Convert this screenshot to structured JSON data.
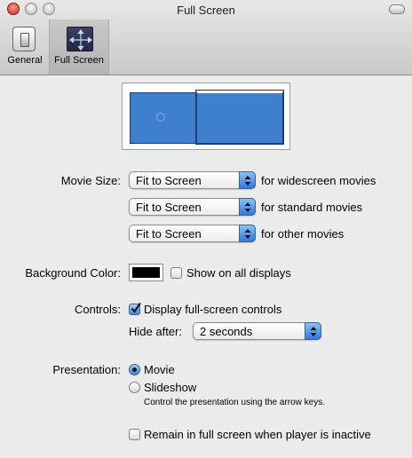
{
  "window": {
    "title": "Full Screen"
  },
  "toolbar": {
    "items": [
      {
        "label": "General",
        "icon": "switch-icon",
        "selected": false
      },
      {
        "label": "Full Screen",
        "icon": "fullscreen-arrows-icon",
        "selected": true
      }
    ]
  },
  "movie_size": {
    "label": "Movie Size:",
    "rows": [
      {
        "value": "Fit to Screen",
        "suffix": "for widescreen movies"
      },
      {
        "value": "Fit to Screen",
        "suffix": "for standard movies"
      },
      {
        "value": "Fit to Screen",
        "suffix": "for other movies"
      }
    ]
  },
  "background": {
    "label": "Background Color:",
    "color": "#000000",
    "show_all_label": "Show on all displays",
    "show_all_checked": false
  },
  "controls": {
    "label": "Controls:",
    "display_label": "Display full-screen controls",
    "display_checked": true,
    "hide_after_label": "Hide after:",
    "hide_after_value": "2 seconds"
  },
  "presentation": {
    "label": "Presentation:",
    "options": [
      {
        "label": "Movie",
        "selected": true
      },
      {
        "label": "Slideshow",
        "selected": false
      }
    ],
    "hint": "Control the presentation using the arrow keys."
  },
  "remain": {
    "label": "Remain in full screen when player is inactive",
    "checked": false
  },
  "colors": {
    "accent": "#3b83d8",
    "screen_blue": "#3e7fce",
    "close_red": "#d3281a"
  }
}
